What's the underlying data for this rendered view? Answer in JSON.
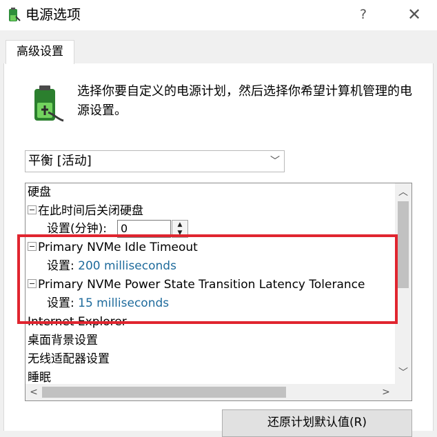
{
  "window": {
    "title": "电源选项",
    "help_label": "?",
    "close_label": "✕"
  },
  "tab": {
    "label": "高级设置"
  },
  "description": "选择你要自定义的电源计划，然后选择你希望计算机管理的电源设置。",
  "plan_select": {
    "value": "平衡 [活动]"
  },
  "tree": {
    "hard_disk": "硬盘",
    "turn_off_disk": "在此时间后关闭硬盘",
    "setting_minutes_label": "设置(分钟):",
    "setting_minutes_value": "0",
    "nvme_idle": "Primary NVMe Idle Timeout",
    "nvme_idle_setting_label": "设置:",
    "nvme_idle_setting_value": "200 milliseconds",
    "nvme_latency": "Primary NVMe Power State Transition Latency Tolerance",
    "nvme_latency_setting_label": "设置:",
    "nvme_latency_setting_value": "15 milliseconds",
    "internet_explorer": "Internet Explorer",
    "desktop_background": "桌面背景设置",
    "wireless_adapter": "无线适配器设置",
    "sleep": "睡眠"
  },
  "buttons": {
    "restore_defaults": "还原计划默认值(R)"
  },
  "colors": {
    "highlight": "#e0252f",
    "link": "#1f6b9c"
  }
}
